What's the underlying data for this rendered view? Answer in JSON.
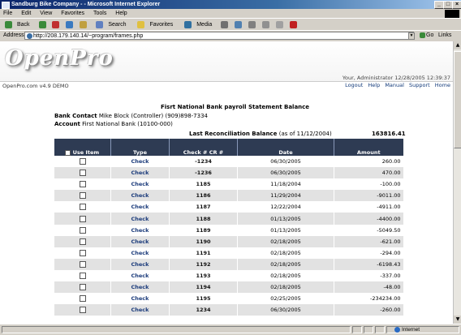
{
  "window": {
    "title": "Sandburg Bike Company - - Microsoft Internet Explorer",
    "min": "_",
    "max": "□",
    "close": "×"
  },
  "menu": [
    "File",
    "Edit",
    "View",
    "Favorites",
    "Tools",
    "Help"
  ],
  "toolbar": {
    "back": "Back",
    "search": "Search",
    "favorites": "Favorites",
    "media": "Media"
  },
  "address": {
    "label": "Address",
    "url": "http://208.179.140.14/~program/frames.php",
    "go": "Go",
    "links": "Links"
  },
  "header": {
    "logo": "OpenPro",
    "userinfo": "Your, Administrator  12/28/2005 12:39:37",
    "version": "OpenPro.com v4.9 DEMO",
    "nav": [
      "Logout",
      "Help",
      "Manual",
      "Support",
      "Home"
    ]
  },
  "statement": {
    "title": "Fisrt National Bank payroll Statement Balance",
    "contact_label": "Bank Contact",
    "contact_value": "Mike Block (Controller) (909)898-7334",
    "account_label": "Account",
    "account_value": "First National Bank (10100-000)",
    "recon_label": "Last Reconciliation Balance",
    "recon_asof": "(as of 11/12/2004)",
    "recon_value": "163816.41"
  },
  "table": {
    "headers": {
      "use_item": "Use Item",
      "type": "Type",
      "check": "Check # CR #",
      "date": "Date",
      "amount": "Amount"
    },
    "rows": [
      {
        "type": "Check",
        "check": "-1234",
        "date": "06/30/2005",
        "amount": "260.00"
      },
      {
        "type": "Check",
        "check": "-1236",
        "date": "06/30/2005",
        "amount": "470.00"
      },
      {
        "type": "Check",
        "check": "1185",
        "date": "11/18/2004",
        "amount": "-100.00"
      },
      {
        "type": "Check",
        "check": "1186",
        "date": "11/29/2004",
        "amount": "-9011.00"
      },
      {
        "type": "Check",
        "check": "1187",
        "date": "12/22/2004",
        "amount": "-4911.00"
      },
      {
        "type": "Check",
        "check": "1188",
        "date": "01/13/2005",
        "amount": "-4400.00"
      },
      {
        "type": "Check",
        "check": "1189",
        "date": "01/13/2005",
        "amount": "-5049.50"
      },
      {
        "type": "Check",
        "check": "1190",
        "date": "02/18/2005",
        "amount": "-621.00"
      },
      {
        "type": "Check",
        "check": "1191",
        "date": "02/18/2005",
        "amount": "-294.00"
      },
      {
        "type": "Check",
        "check": "1192",
        "date": "02/18/2005",
        "amount": "-6198.43"
      },
      {
        "type": "Check",
        "check": "1193",
        "date": "02/18/2005",
        "amount": "-337.00"
      },
      {
        "type": "Check",
        "check": "1194",
        "date": "02/18/2005",
        "amount": "-48.00"
      },
      {
        "type": "Check",
        "check": "1195",
        "date": "02/25/2005",
        "amount": "-234234.00"
      },
      {
        "type": "Check",
        "check": "1234",
        "date": "06/30/2005",
        "amount": "-260.00"
      }
    ]
  },
  "status": {
    "zone": "Internet"
  }
}
